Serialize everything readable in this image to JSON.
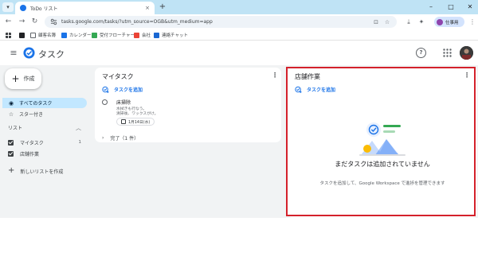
{
  "browser": {
    "tab_title": "ToDo リスト",
    "tab_close": "×",
    "new_tab": "+",
    "window_controls": {
      "minimize": "–",
      "maximize": "□",
      "close": "✕"
    },
    "url": "tasks.google.com/tasks/?utm_source=OGB&utm_medium=app",
    "profile_label": "仕事用",
    "colors": {
      "tabbar": "#bfe3f5",
      "accent": "#1a73e8"
    }
  },
  "bookmarks": [
    {
      "label": "",
      "icon": "apps-grid-icon",
      "color": "#3c4043"
    },
    {
      "label": "",
      "icon": "bookmark-icon",
      "color": "#202124"
    },
    {
      "label": "顧客名簿",
      "icon": "sheet-icon",
      "color": "#5f6368"
    },
    {
      "label": "カレンダー",
      "icon": "calendar-icon",
      "color": "#1a73e8"
    },
    {
      "label": "受付フローチャート",
      "icon": "slides-icon",
      "color": "#34a853"
    },
    {
      "label": "会社",
      "icon": "gmail-icon",
      "color": "#ea4335"
    },
    {
      "label": "連絡チャット",
      "icon": "sites-icon",
      "color": "#1967d2"
    }
  ],
  "app": {
    "title": "タスク",
    "help_glyph": "?",
    "hamburger_glyph": "≡"
  },
  "sidebar": {
    "create_label": "作成",
    "create_plus": "+",
    "items": [
      {
        "label": "すべてのタスク",
        "icon": "task-check-icon",
        "glyph": "◉",
        "active": true
      },
      {
        "label": "スター付き",
        "icon": "star-icon",
        "glyph": "☆",
        "active": false
      }
    ],
    "lists_heading": "リスト",
    "lists_chevron": "︿",
    "lists": [
      {
        "label": "マイタスク",
        "count": "1",
        "checked": true
      },
      {
        "label": "店舗作業",
        "count": "",
        "checked": true
      }
    ],
    "new_list_label": "新しいリストを作成",
    "new_list_plus": "+"
  },
  "lists_panel": [
    {
      "title": "マイタスク",
      "add_task_label": "タスクを追加",
      "more_glyph": "⋮",
      "tasks": [
        {
          "title": "床掃除",
          "details": [
            "水拭きも行なう。",
            "清掃後、ワックスがけ。"
          ],
          "date": "1月14日(水)"
        }
      ],
      "completed_label": "完了（1 件）",
      "completed_chevron": "›"
    },
    {
      "title": "店舗作業",
      "add_task_label": "タスクを追加",
      "more_glyph": "⋮",
      "empty_title": "まだタスクは追加されていません",
      "empty_description": "タスクを追加して、Google Workspace で進捗を管理できます",
      "highlight_color": "#d4212b"
    }
  ]
}
